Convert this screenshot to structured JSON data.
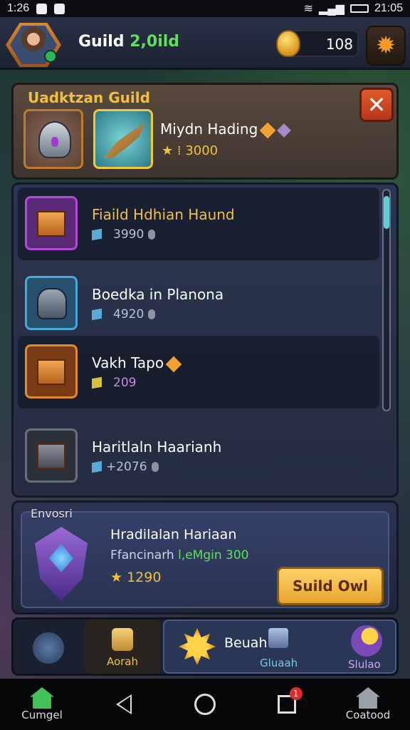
{
  "status_bar": {
    "time_left": "1:26",
    "time_right": "21:05"
  },
  "header": {
    "guild_label": "Guild",
    "guild_number": "2,0ild",
    "coins": "108",
    "settings_icon": "gear-icon"
  },
  "top_panel": {
    "title": "Uadktzan Guild",
    "close_label": "✕",
    "item_name": "Miydn Hading",
    "item_stat": "3000"
  },
  "list": [
    {
      "name": "Fiaild Hdhian Haund",
      "stat": "3990",
      "color": "#b04ad6"
    },
    {
      "name": "Boedka in Planona",
      "stat": "4920",
      "color": "#48a8d8"
    },
    {
      "name": "Vakh Tapo",
      "stat": "209",
      "color": "#e08a2a"
    },
    {
      "name": "Haritlaln Haarianh",
      "stat": "+2076",
      "color": "#6a6e78"
    }
  ],
  "event": {
    "label": "Envosri",
    "title": "Hradilalan Hariaan",
    "sub_prefix": "Ffancinarh ",
    "sub_highlight": "l,eMgin 300",
    "stat": "1290",
    "button": "Suild Owl"
  },
  "tabs": {
    "tab2_label": "Aorah",
    "tab3_title": "Beuah",
    "tab3_sub": "Gluaah",
    "tab3_right": "Slulao"
  },
  "nav": {
    "left_label": "Cumgel",
    "right_label": "Coatood",
    "recent_badge": "1"
  },
  "colors": {
    "accent": "#f2c040",
    "green": "#5ee05a",
    "close": "#e05a2c",
    "button": "#ffd26a"
  }
}
